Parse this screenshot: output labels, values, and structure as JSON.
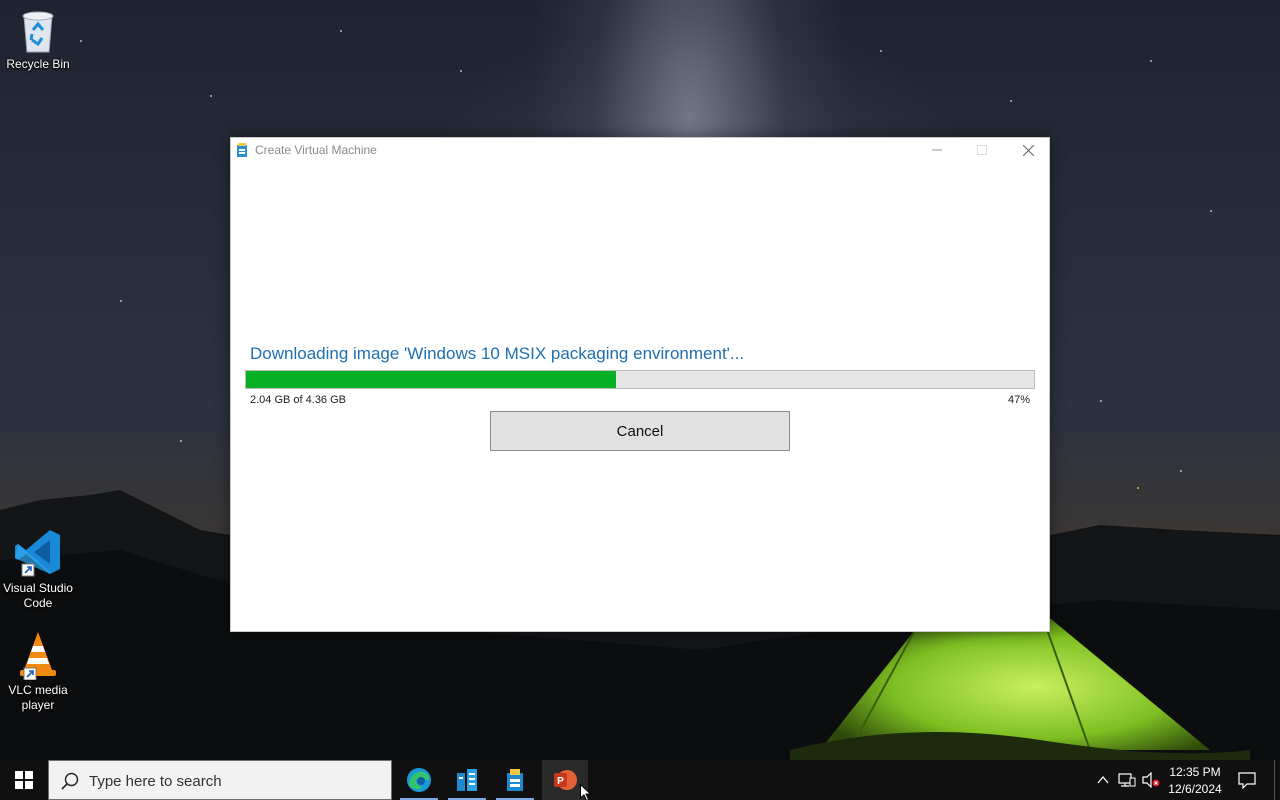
{
  "desktop": {
    "icons": [
      {
        "label": "Recycle Bin",
        "icon": "recycle-bin-icon"
      },
      {
        "label": "Visual Studio Code",
        "icon": "vscode-icon"
      },
      {
        "label": "VLC media player",
        "icon": "vlc-icon"
      }
    ]
  },
  "window": {
    "title": "Create Virtual Machine",
    "status_message": "Downloading image 'Windows 10 MSIX packaging environment'...",
    "downloaded_text": "2.04 GB of 4.36 GB",
    "percent_text": "47%",
    "progress_fraction": 0.47,
    "cancel_label": "Cancel"
  },
  "taskbar": {
    "search_placeholder": "Type here to search",
    "apps": [
      {
        "name": "Microsoft Edge",
        "icon": "edge-icon",
        "running": true
      },
      {
        "name": "Hyper-V Manager",
        "icon": "hyperv-manager-icon",
        "running": true
      },
      {
        "name": "Hyper-V Quick Create",
        "icon": "hyperv-quick-create-icon",
        "running": true
      },
      {
        "name": "PowerPoint",
        "icon": "powerpoint-icon",
        "running": false
      }
    ],
    "clock_time": "12:35 PM",
    "clock_date": "12/6/2024"
  },
  "colors": {
    "progress_fill": "#06b025",
    "status_text": "#1f6fb0",
    "taskbar": "#101010"
  }
}
